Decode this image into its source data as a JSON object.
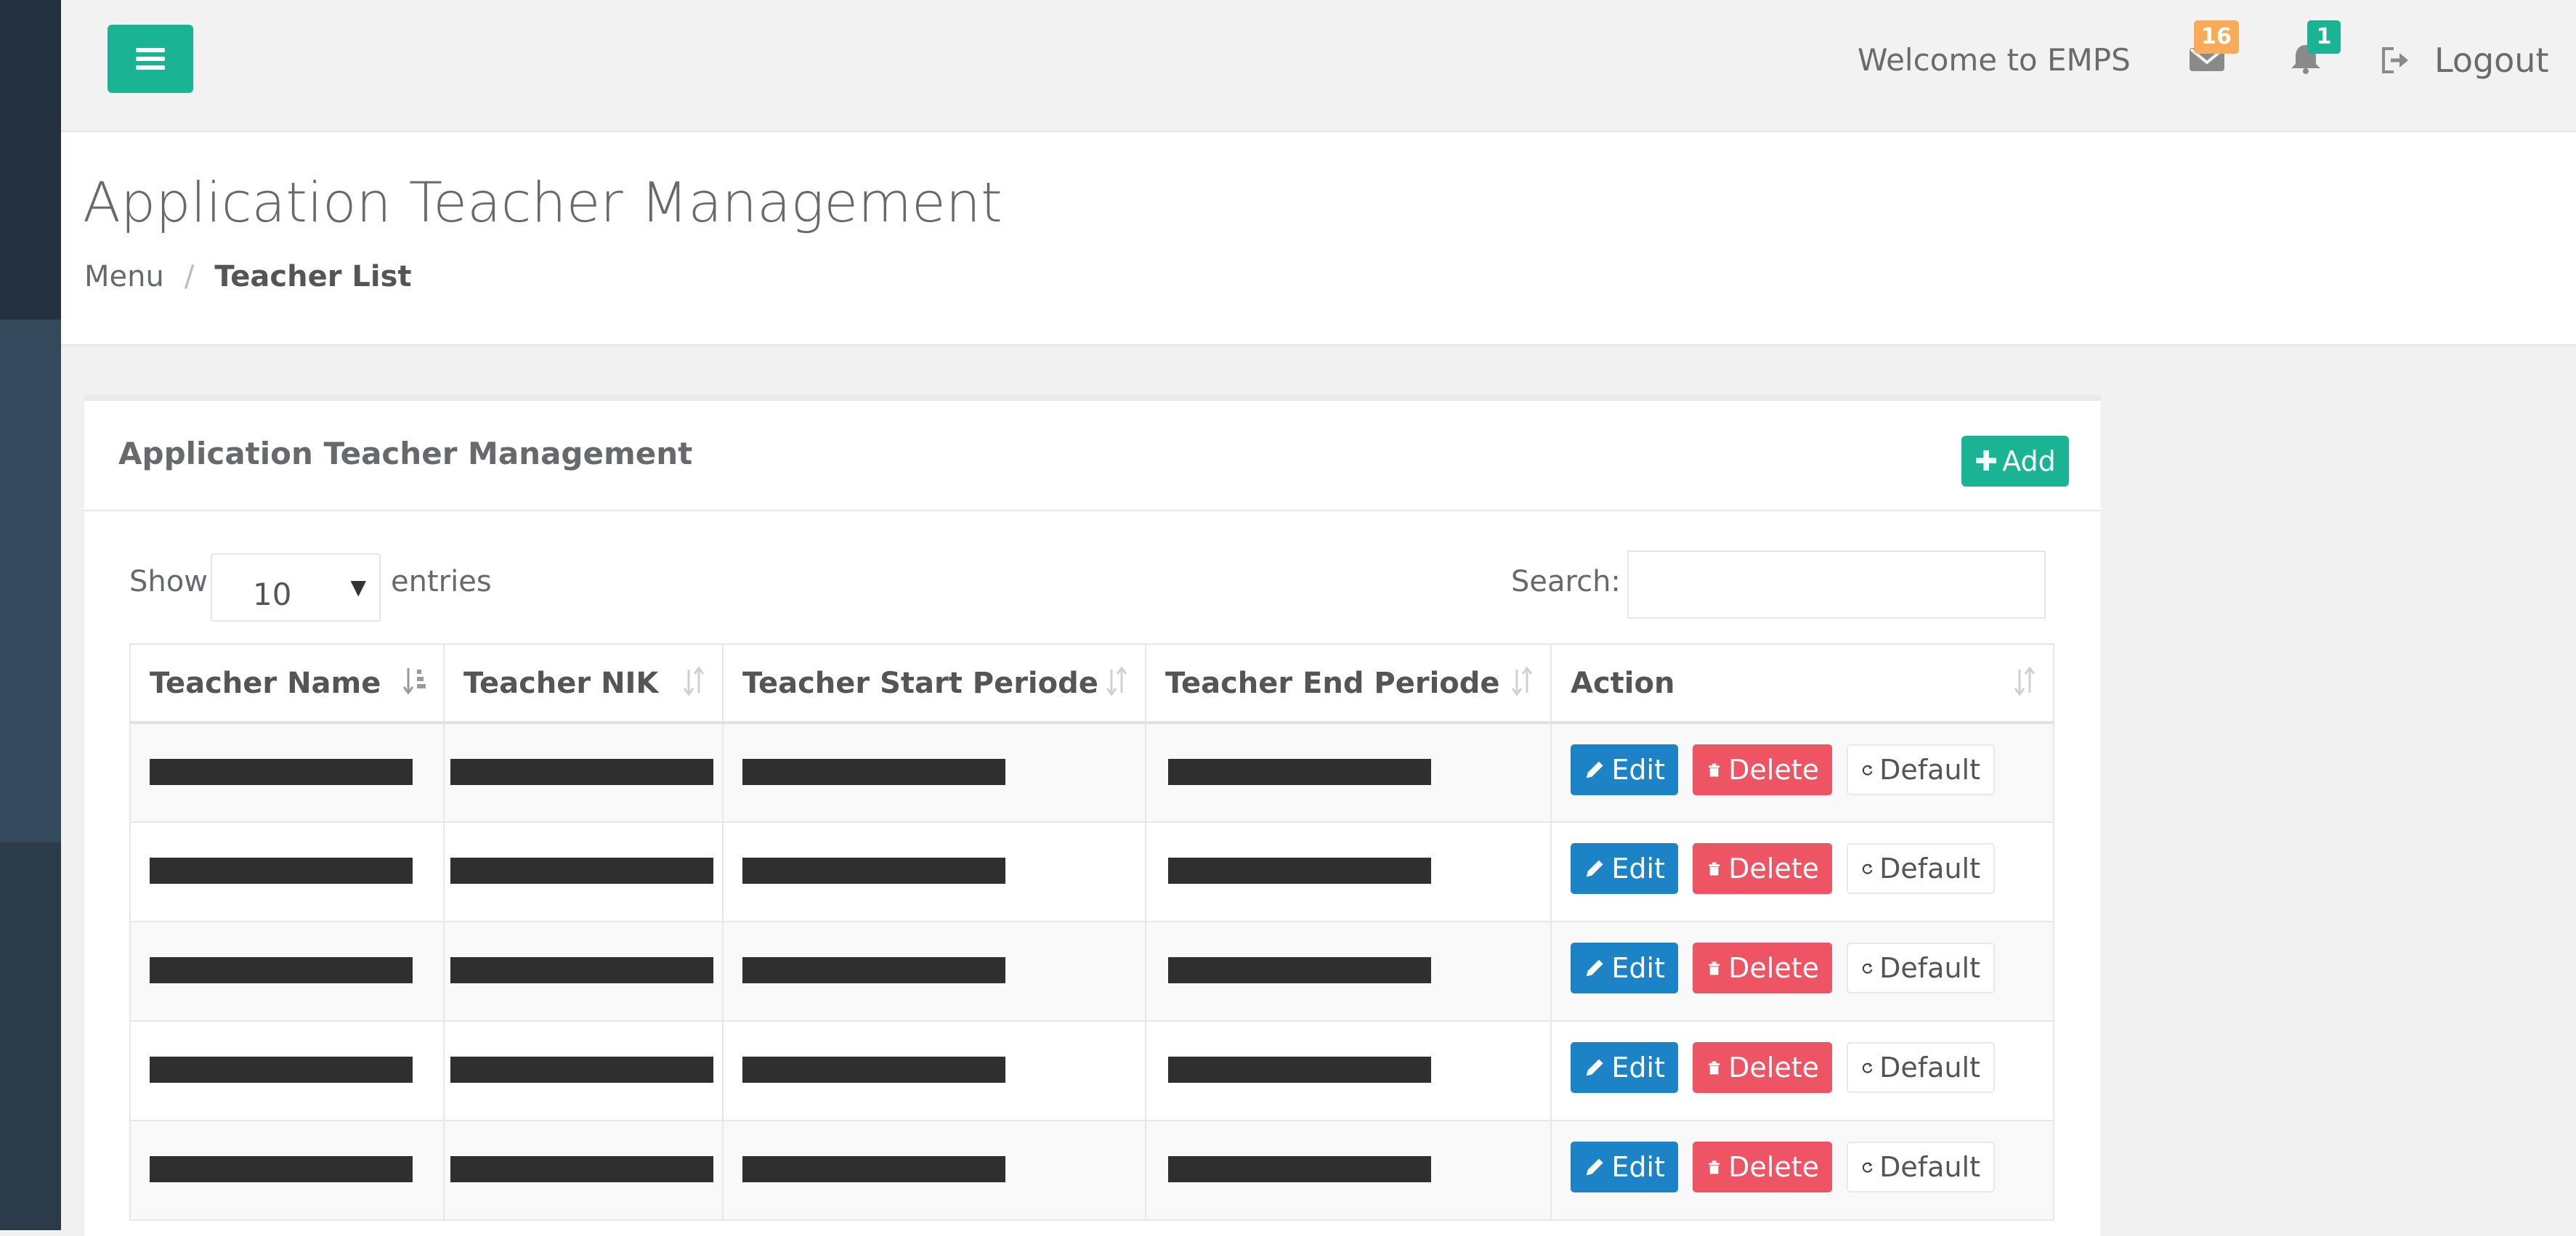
{
  "topbar": {
    "welcome": "Welcome to EMPS",
    "mail_count": "16",
    "alert_count": "1",
    "logout": "Logout"
  },
  "header": {
    "title": "Application Teacher Management",
    "breadcrumb": [
      "Menu",
      "Teacher List"
    ]
  },
  "panel": {
    "title": "Application Teacher Management",
    "add_label": "Add",
    "show_label": "Show",
    "page_size": "10",
    "entries_label": "entries",
    "search_label": "Search:",
    "search_value": ""
  },
  "table": {
    "columns": [
      "Teacher Name",
      "Teacher NIK",
      "Teacher Start Periode",
      "Teacher End Periode",
      "Action"
    ],
    "action_labels": {
      "edit": "Edit",
      "delete": "Delete",
      "default": "Default"
    },
    "rows_note_redacted": true,
    "row_count_visible": 5
  },
  "colors": {
    "primary": "#1ab394",
    "edit": "#1c84c6",
    "delete": "#ed5565",
    "mail_badge": "#f8ac59",
    "alert_badge": "#1ab394",
    "sidebar": "#2b3b4a"
  }
}
